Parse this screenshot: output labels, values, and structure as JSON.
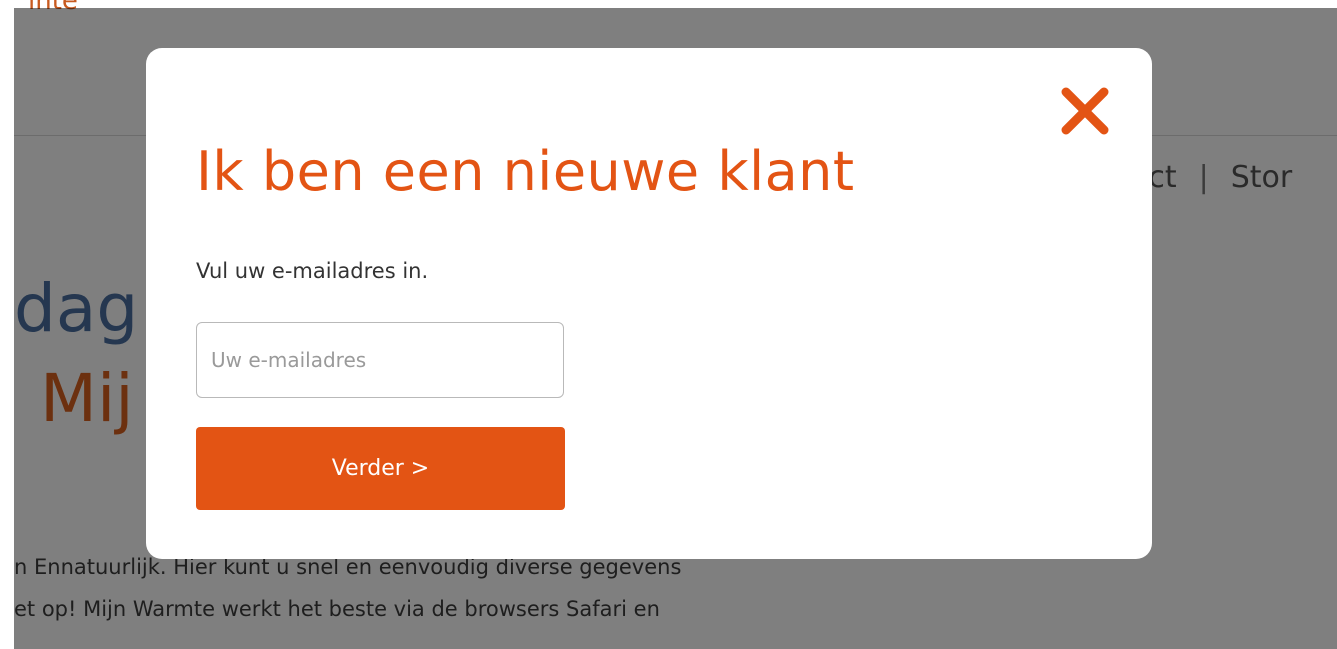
{
  "background": {
    "logo_text": "ınte",
    "nav": {
      "item_contact": "act",
      "separator": "|",
      "item_storing": "Stor"
    },
    "hero_line1": "dag",
    "hero_line2": "Mij",
    "paragraph_line1": "n Ennatuurlijk. Hier kunt u snel en eenvoudig diverse gegevens",
    "paragraph_line2": "et op! Mijn Warmte werkt het beste via de browsers Safari en"
  },
  "modal": {
    "title": "Ik ben een nieuwe klant",
    "instruction": "Vul uw e-mailadres in.",
    "email_input": {
      "placeholder": "Uw e-mailadres",
      "value": ""
    },
    "continue_button_label": "Verder >",
    "close_icon": "close-icon"
  },
  "colors": {
    "accent": "#e35414",
    "overlay": "rgba(0,0,0,0.5)",
    "hero_blue": "#4a6fa0"
  }
}
